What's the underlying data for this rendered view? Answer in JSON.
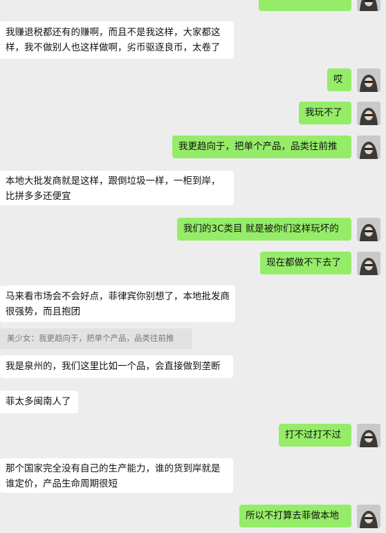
{
  "messages": [
    {
      "side": "out",
      "text": ""
    },
    {
      "side": "in",
      "text": "我赚退税都还有的赚啊，而且不是我这样，大家都这样，我不做别人也这样做啊，劣币驱逐良币，太卷了"
    },
    {
      "side": "out",
      "text": "哎"
    },
    {
      "side": "out",
      "text": "我玩不了"
    },
    {
      "side": "out",
      "text": "我更趋向于，把单个产品，品类往前推"
    },
    {
      "side": "in",
      "text": "本地大批发商就是这样，跟倒垃圾一样，一柜到岸，比拼多多还便宜"
    },
    {
      "side": "out",
      "text": "我们的3C类目 就是被你们这样玩坏的"
    },
    {
      "side": "out",
      "text": "现在都做不下去了"
    },
    {
      "side": "in",
      "text": "马来看市场会不会好点，菲律宾你别想了，本地批发商很强势，而且抱团"
    },
    {
      "side": "in",
      "text": "我是泉州的，我们这里比如一个品，会直接做到垄断"
    },
    {
      "side": "in",
      "text": "菲太多闽南人了"
    },
    {
      "side": "out",
      "text": "打不过打不过"
    },
    {
      "side": "in",
      "text": "那个国家完全没有自己的生产能力，谁的货到岸就是谁定价，产品生命周期很短"
    },
    {
      "side": "out",
      "text": "所以不打算去菲做本地"
    }
  ],
  "quote": {
    "text": "美少女：我更趋向于，把单个产品，品类往前推"
  },
  "avatar": {
    "icon": "user-avatar-hoodie"
  }
}
